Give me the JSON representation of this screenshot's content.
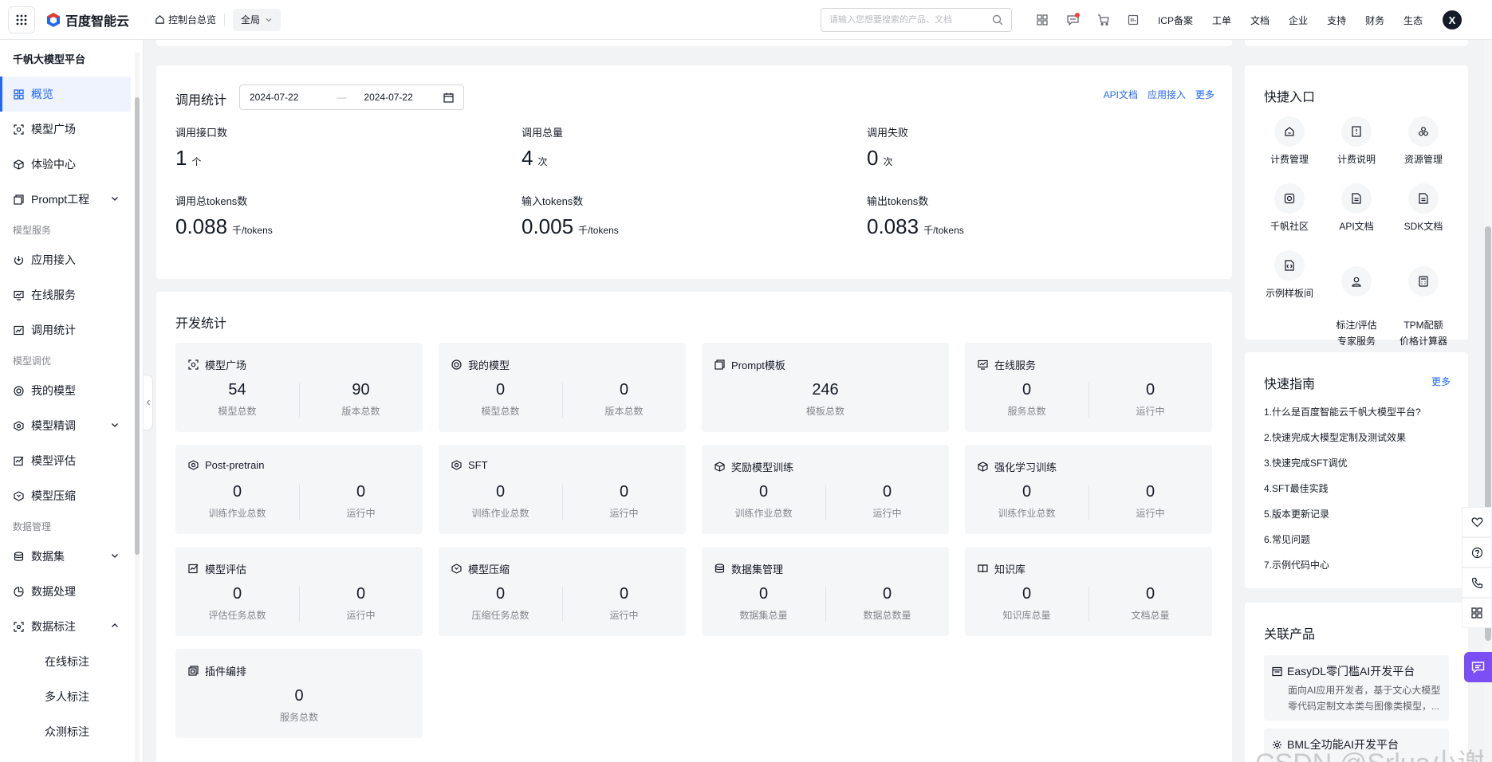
{
  "topbar": {
    "brand": "百度智能云",
    "home": "控制台总览",
    "region": "全局",
    "search_placeholder": "请输入您想要搜索的产品、文档",
    "menu": [
      "ICP备案",
      "工单",
      "文档",
      "企业",
      "支持",
      "财务",
      "生态"
    ],
    "avatar": "X"
  },
  "sidebar": {
    "title": "千帆大模型平台",
    "items_top": [
      {
        "label": "概览",
        "icon": "grid-icon",
        "active": true
      },
      {
        "label": "模型广场",
        "icon": "model-square-icon"
      },
      {
        "label": "体验中心",
        "icon": "cube-icon"
      },
      {
        "label": "Prompt工程",
        "icon": "prompt-icon",
        "chevron": true
      }
    ],
    "group1": "模型服务",
    "items_service": [
      {
        "label": "应用接入",
        "icon": "app-access-icon"
      },
      {
        "label": "在线服务",
        "icon": "online-service-icon"
      },
      {
        "label": "调用统计",
        "icon": "stats-icon"
      }
    ],
    "group2": "模型调优",
    "items_tune": [
      {
        "label": "我的模型",
        "icon": "my-model-icon"
      },
      {
        "label": "模型精调",
        "icon": "finetune-icon",
        "chevron": true
      },
      {
        "label": "模型评估",
        "icon": "evaluate-icon"
      },
      {
        "label": "模型压缩",
        "icon": "compress-icon"
      }
    ],
    "group3": "数据管理",
    "items_data": [
      {
        "label": "数据集",
        "icon": "dataset-icon",
        "chevron": true
      },
      {
        "label": "数据处理",
        "icon": "data-process-icon"
      },
      {
        "label": "数据标注",
        "icon": "annotate-icon",
        "chevron_up": true
      }
    ],
    "subitems": [
      "在线标注",
      "多人标注",
      "众测标注"
    ]
  },
  "call_stats": {
    "title": "调用统计",
    "date_start": "2024-07-22",
    "date_sep": "—",
    "date_end": "2024-07-22",
    "links": [
      "API文档",
      "应用接入",
      "更多"
    ],
    "stats": [
      {
        "label": "调用接口数",
        "value": "1",
        "unit": "个"
      },
      {
        "label": "调用总量",
        "value": "4",
        "unit": "次"
      },
      {
        "label": "调用失败",
        "value": "0",
        "unit": "次"
      },
      {
        "label": "调用总tokens数",
        "value": "0.088",
        "unit": "千/tokens"
      },
      {
        "label": "输入tokens数",
        "value": "0.005",
        "unit": "千/tokens"
      },
      {
        "label": "输出tokens数",
        "value": "0.083",
        "unit": "千/tokens"
      }
    ]
  },
  "dev_stats": {
    "title": "开发统计",
    "tiles": [
      {
        "name": "模型广场",
        "icon": "model-square-icon",
        "cols": [
          {
            "n": "54",
            "c": "模型总数"
          },
          {
            "n": "90",
            "c": "版本总数"
          }
        ]
      },
      {
        "name": "我的模型",
        "icon": "my-model-icon",
        "cols": [
          {
            "n": "0",
            "c": "模型总数"
          },
          {
            "n": "0",
            "c": "版本总数"
          }
        ]
      },
      {
        "name": "Prompt模板",
        "icon": "prompt-icon",
        "cols": [
          {
            "n": "246",
            "c": "模板总数"
          }
        ]
      },
      {
        "name": "在线服务",
        "icon": "online-service-icon",
        "cols": [
          {
            "n": "0",
            "c": "服务总数"
          },
          {
            "n": "0",
            "c": "运行中"
          }
        ]
      },
      {
        "name": "Post-pretrain",
        "icon": "hexagon-icon",
        "cols": [
          {
            "n": "0",
            "c": "训练作业总数"
          },
          {
            "n": "0",
            "c": "运行中"
          }
        ]
      },
      {
        "name": "SFT",
        "icon": "hexagon-icon",
        "cols": [
          {
            "n": "0",
            "c": "训练作业总数"
          },
          {
            "n": "0",
            "c": "运行中"
          }
        ]
      },
      {
        "name": "奖励模型训练",
        "icon": "box-icon",
        "cols": [
          {
            "n": "0",
            "c": "训练作业总数"
          },
          {
            "n": "0",
            "c": "运行中"
          }
        ]
      },
      {
        "name": "强化学习训练",
        "icon": "box-icon",
        "cols": [
          {
            "n": "0",
            "c": "训练作业总数"
          },
          {
            "n": "0",
            "c": "运行中"
          }
        ]
      },
      {
        "name": "模型评估",
        "icon": "evaluate-icon",
        "cols": [
          {
            "n": "0",
            "c": "评估任务总数"
          },
          {
            "n": "0",
            "c": "运行中"
          }
        ]
      },
      {
        "name": "模型压缩",
        "icon": "compress-icon",
        "cols": [
          {
            "n": "0",
            "c": "压缩任务总数"
          },
          {
            "n": "0",
            "c": "运行中"
          }
        ]
      },
      {
        "name": "数据集管理",
        "icon": "dataset-icon",
        "cols": [
          {
            "n": "0",
            "c": "数据集总量"
          },
          {
            "n": "0",
            "c": "数据总数量"
          }
        ]
      },
      {
        "name": "知识库",
        "icon": "book-icon",
        "cols": [
          {
            "n": "0",
            "c": "知识库总量"
          },
          {
            "n": "0",
            "c": "文档总量"
          }
        ]
      },
      {
        "name": "插件编排",
        "icon": "plugin-icon",
        "cols": [
          {
            "n": "0",
            "c": "服务总数"
          }
        ]
      }
    ]
  },
  "quick_entry": {
    "title": "快捷入口",
    "items": [
      {
        "label": "计费管理",
        "icon": "billing-icon"
      },
      {
        "label": "计费说明",
        "icon": "billing-doc-icon"
      },
      {
        "label": "资源管理",
        "icon": "resource-icon"
      },
      {
        "label": "千帆社区",
        "icon": "community-icon"
      },
      {
        "label": "API文档",
        "icon": "doc-icon"
      },
      {
        "label": "SDK文档",
        "icon": "doc-icon"
      },
      {
        "label": "示例样板间",
        "icon": "sample-icon"
      },
      {
        "label": "标注/评估\n专家服务",
        "icon": "expert-icon"
      },
      {
        "label": "TPM配额\n价格计算器",
        "icon": "calculator-icon"
      }
    ]
  },
  "quick_guide": {
    "title": "快速指南",
    "more": "更多",
    "items": [
      "1.什么是百度智能云千帆大模型平台?",
      "2.快速完成大模型定制及测试效果",
      "3.快速完成SFT调优",
      "4.SFT最佳实践",
      "5.版本更新记录",
      "6.常见问题",
      "7.示例代码中心"
    ]
  },
  "related": {
    "title": "关联产品",
    "items": [
      {
        "name": "EasyDL零门槛AI开发平台",
        "desc1": "面向AI应用开发者，基于文心大模型",
        "desc2": "零代码定制文本类与图像类模型，..."
      },
      {
        "name": "BML全功能AI开发平台"
      }
    ]
  },
  "watermark": "CSDN @Srlua小谢",
  "colors": {
    "accent": "#2468f2",
    "chat": "#7b4ef6",
    "tile_bg": "#f5f6f8",
    "page_bg": "#f2f3f5"
  }
}
